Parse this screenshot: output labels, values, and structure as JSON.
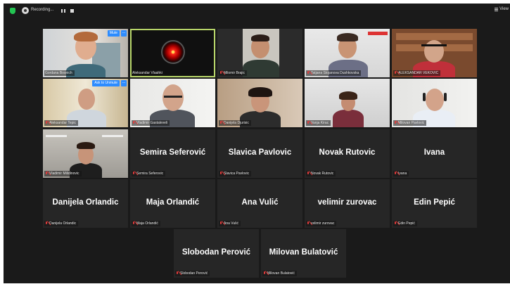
{
  "topbar": {
    "recording_label": "Recording...",
    "view_label": "View"
  },
  "overlays": {
    "mute_label": "Mute",
    "ask_unmute_label": "Ask to Unmute",
    "more_label": "..."
  },
  "tiles": [
    {
      "label": "Gordana Bosnich",
      "display_name": ""
    },
    {
      "label": "Aleksandar Vlaahki",
      "display_name": ""
    },
    {
      "label": "Milomir Brajic",
      "display_name": ""
    },
    {
      "label": "Tatjana Stojanova Dushkovska",
      "display_name": ""
    },
    {
      "label": "ALEKSANDAR VEKOVIC",
      "display_name": ""
    },
    {
      "label": "Aleksandar Tepic",
      "display_name": ""
    },
    {
      "label": "Vladimir Gastaleveli",
      "display_name": ""
    },
    {
      "label": "Danijela Djurisic",
      "display_name": ""
    },
    {
      "label": "Vanja Kirac",
      "display_name": ""
    },
    {
      "label": "Milovan Pavlovic",
      "display_name": ""
    },
    {
      "label": "Vladimir Milidinovic",
      "display_name": ""
    },
    {
      "label": "Semira Seferovic",
      "display_name": "Semira Seferović"
    },
    {
      "label": "Slavica Pavlovic",
      "display_name": "Slavica Pavlovic"
    },
    {
      "label": "Novak Rutovic",
      "display_name": "Novak Rutovic"
    },
    {
      "label": "Ivana",
      "display_name": "Ivana"
    },
    {
      "label": "Danijela Orlandic",
      "display_name": "Danijela Orlandic"
    },
    {
      "label": "Maja Orlandić",
      "display_name": "Maja Orlandić"
    },
    {
      "label": "Ana Vulić",
      "display_name": "Ana Vulić"
    },
    {
      "label": "velimir zurovac",
      "display_name": "velimir zurovac"
    },
    {
      "label": "Edin Pepić",
      "display_name": "Edin Pepić"
    },
    {
      "label": "Slobodan Perović",
      "display_name": "Slobodan Perović"
    },
    {
      "label": "Milovan Bulatović",
      "display_name": "Milovan Bulatović"
    }
  ],
  "colors": {
    "active_speaker_border": "#b8d66a",
    "muted_icon": "#e23b3b",
    "button_blue": "#2d8cff",
    "background": "#1a1a1a",
    "tile_background": "#262626"
  }
}
